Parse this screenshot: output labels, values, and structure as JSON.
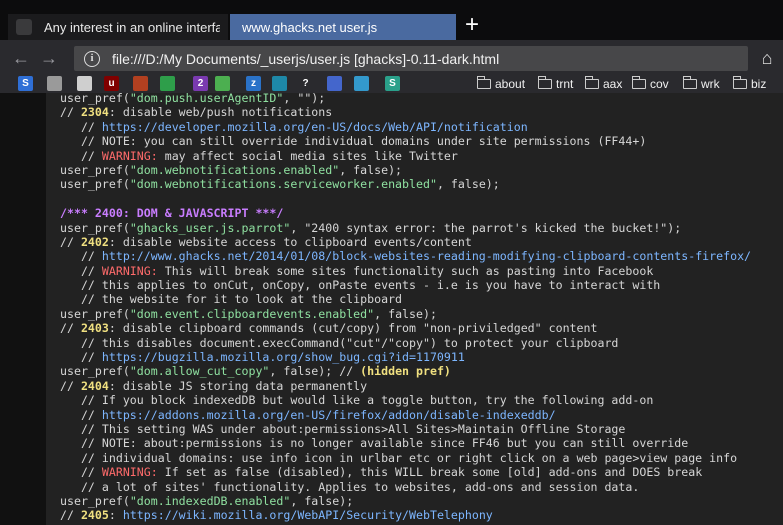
{
  "tabs": [
    {
      "title": "Any interest in an online interfa"
    },
    {
      "title": "www.ghacks.net user.js"
    }
  ],
  "nav": {
    "url": "file:///D:/My Documents/_userjs/user.js [ghacks]-0.11-dark.html"
  },
  "bookmarks": {
    "icons": [
      {
        "name": "s-icon",
        "glyph": "S",
        "color": "#2f6fd6"
      },
      {
        "name": "page-icon",
        "glyph": "",
        "color": "#9a9a9a"
      },
      {
        "name": "grid-icon",
        "glyph": "",
        "color": "#cfcfcf"
      },
      {
        "name": "ublock-icon",
        "glyph": "u",
        "color": "#800000"
      },
      {
        "name": "trash-icon",
        "glyph": "",
        "color": "#b24020"
      },
      {
        "name": "recycle-icon",
        "glyph": "",
        "color": "#2e9e4a"
      },
      {
        "name": "badge-icon",
        "glyph": "2",
        "color": "#7a3ab0"
      },
      {
        "name": "leaf-icon",
        "glyph": "",
        "color": "#4caf50"
      },
      {
        "name": "zotero-icon",
        "glyph": "z",
        "color": "#2a72c8"
      },
      {
        "name": "eye-icon",
        "glyph": "",
        "color": "#1e88a8"
      },
      {
        "name": "question-icon",
        "glyph": "?",
        "color": "#2a2a2e"
      },
      {
        "name": "arrows-icon",
        "glyph": "",
        "color": "#4466cc"
      },
      {
        "name": "refresh-icon",
        "glyph": "",
        "color": "#3399cc"
      },
      {
        "name": "s2-icon",
        "glyph": "S",
        "color": "#2aa08a"
      }
    ],
    "folders": [
      "about",
      "trnt",
      "aax",
      "cov",
      "wrk",
      "biz"
    ]
  },
  "code_lines": [
    [
      {
        "t": "user_pref(",
        "c": "c"
      },
      {
        "t": "\"dom.push.userAgentID\"",
        "c": "str"
      },
      {
        "t": ", \"\");",
        "c": "c"
      }
    ],
    [
      {
        "t": "// ",
        "c": "c"
      },
      {
        "t": "2304",
        "c": "num"
      },
      {
        "t": ": disable web/push notifications",
        "c": "c"
      }
    ],
    [
      {
        "t": "   // ",
        "c": "c"
      },
      {
        "t": "https://developer.mozilla.org/en-US/docs/Web/API/notification",
        "c": "url-t"
      }
    ],
    [
      {
        "t": "   // NOTE: you can still override individual domains under site permissions (FF44+)",
        "c": "c"
      }
    ],
    [
      {
        "t": "   // ",
        "c": "c"
      },
      {
        "t": "WARNING:",
        "c": "warn"
      },
      {
        "t": " may affect social media sites like Twitter",
        "c": "c"
      }
    ],
    [
      {
        "t": "user_pref(",
        "c": "c"
      },
      {
        "t": "\"dom.webnotifications.enabled\"",
        "c": "str"
      },
      {
        "t": ", false);",
        "c": "c"
      }
    ],
    [
      {
        "t": "user_pref(",
        "c": "c"
      },
      {
        "t": "\"dom.webnotifications.serviceworker.enabled\"",
        "c": "str"
      },
      {
        "t": ", false);",
        "c": "c"
      }
    ],
    [
      {
        "t": "",
        "c": "c"
      }
    ],
    [
      {
        "t": "/*** 2400: DOM & JAVASCRIPT ***/",
        "c": "sec"
      }
    ],
    [
      {
        "t": "user_pref(",
        "c": "c"
      },
      {
        "t": "\"ghacks_user.js.parrot\"",
        "c": "str"
      },
      {
        "t": ", \"2400 syntax error: the parrot's kicked the bucket!\");",
        "c": "c"
      }
    ],
    [
      {
        "t": "// ",
        "c": "c"
      },
      {
        "t": "2402",
        "c": "num"
      },
      {
        "t": ": disable website access to clipboard events/content",
        "c": "c"
      }
    ],
    [
      {
        "t": "   // ",
        "c": "c"
      },
      {
        "t": "http://www.ghacks.net/2014/01/08/block-websites-reading-modifying-clipboard-contents-firefox/",
        "c": "url-t"
      }
    ],
    [
      {
        "t": "   // ",
        "c": "c"
      },
      {
        "t": "WARNING:",
        "c": "warn"
      },
      {
        "t": " This will break some sites functionality such as pasting into Facebook",
        "c": "c"
      }
    ],
    [
      {
        "t": "   // this applies to onCut, onCopy, onPaste events - i.e is you have to interact with",
        "c": "c"
      }
    ],
    [
      {
        "t": "   // the website for it to look at the clipboard",
        "c": "c"
      }
    ],
    [
      {
        "t": "user_pref(",
        "c": "c"
      },
      {
        "t": "\"dom.event.clipboardevents.enabled\"",
        "c": "str"
      },
      {
        "t": ", false);",
        "c": "c"
      }
    ],
    [
      {
        "t": "// ",
        "c": "c"
      },
      {
        "t": "2403",
        "c": "num"
      },
      {
        "t": ": disable clipboard commands (cut/copy) from \"non-priviledged\" content",
        "c": "c"
      }
    ],
    [
      {
        "t": "   // this disables document.execCommand(\"cut\"/\"copy\") to protect your clipboard",
        "c": "c"
      }
    ],
    [
      {
        "t": "   // ",
        "c": "c"
      },
      {
        "t": "https://bugzilla.mozilla.org/show_bug.cgi?id=1170911",
        "c": "url-t"
      }
    ],
    [
      {
        "t": "user_pref(",
        "c": "c"
      },
      {
        "t": "\"dom.allow_cut_copy\"",
        "c": "str"
      },
      {
        "t": ", false); // ",
        "c": "c"
      },
      {
        "t": "(hidden pref)",
        "c": "hid"
      }
    ],
    [
      {
        "t": "// ",
        "c": "c"
      },
      {
        "t": "2404",
        "c": "num"
      },
      {
        "t": ": disable JS storing data permanently",
        "c": "c"
      }
    ],
    [
      {
        "t": "   // If you block indexedDB but would like a toggle button, try the following add-on",
        "c": "c"
      }
    ],
    [
      {
        "t": "   // ",
        "c": "c"
      },
      {
        "t": "https://addons.mozilla.org/en-US/firefox/addon/disable-indexeddb/",
        "c": "url-t"
      }
    ],
    [
      {
        "t": "   // This setting WAS under about:permissions>All Sites>Maintain Offline Storage",
        "c": "c"
      }
    ],
    [
      {
        "t": "   // NOTE: about:permissions is no longer available since FF46 but you can still override",
        "c": "c"
      }
    ],
    [
      {
        "t": "   // individual domains: use info icon in urlbar etc or right click on a web page>view page info",
        "c": "c"
      }
    ],
    [
      {
        "t": "   // ",
        "c": "c"
      },
      {
        "t": "WARNING:",
        "c": "warn"
      },
      {
        "t": " If set as false (disabled), this WILL break some [old] add-ons and DOES break",
        "c": "c"
      }
    ],
    [
      {
        "t": "   // a lot of sites' functionality. Applies to websites, add-ons and session data.",
        "c": "c"
      }
    ],
    [
      {
        "t": "user_pref(",
        "c": "c"
      },
      {
        "t": "\"dom.indexedDB.enabled\"",
        "c": "str"
      },
      {
        "t": ", false);",
        "c": "c"
      }
    ],
    [
      {
        "t": "// ",
        "c": "c"
      },
      {
        "t": "2405",
        "c": "num"
      },
      {
        "t": ": ",
        "c": "c"
      },
      {
        "t": "https://wiki.mozilla.org/WebAPI/Security/WebTelephony",
        "c": "url-t"
      }
    ]
  ]
}
